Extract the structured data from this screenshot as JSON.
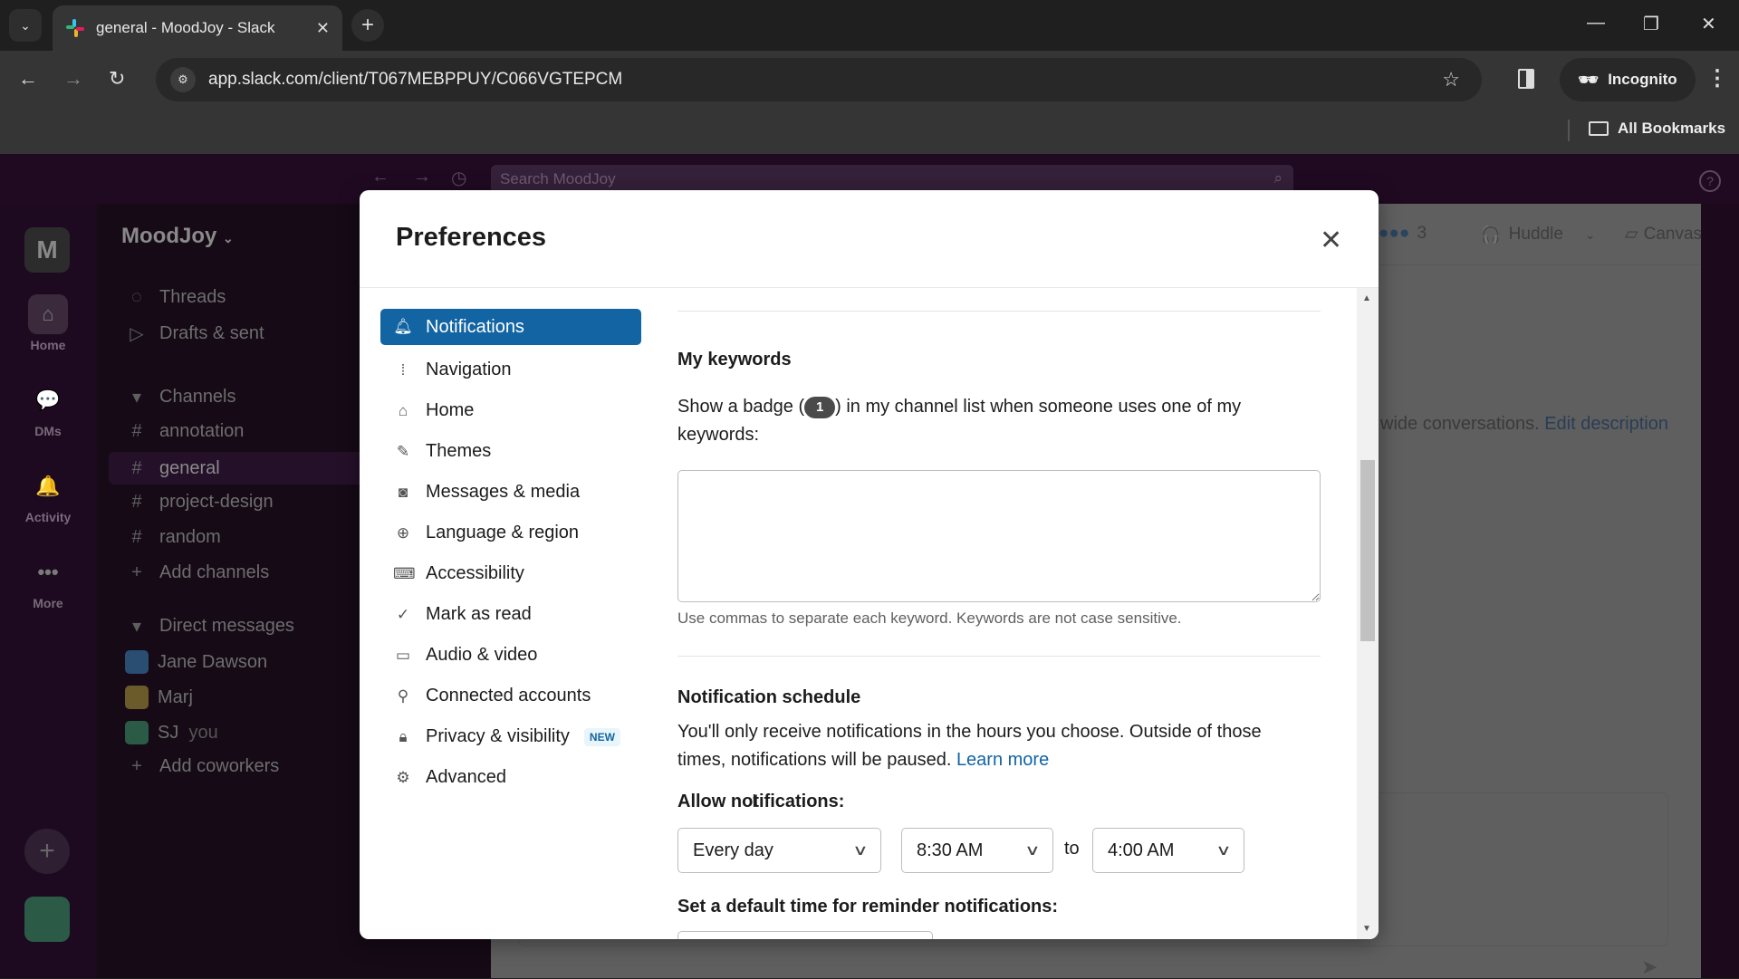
{
  "browser": {
    "tab_title": "general - MoodJoy - Slack",
    "url": "app.slack.com/client/T067MEBPPUY/C066VGTEPCM",
    "profile_label": "Incognito",
    "bookmarks_label": "All Bookmarks"
  },
  "slack": {
    "search_placeholder": "Search MoodJoy",
    "workspace_initial": "M",
    "workspace_name": "MoodJoy",
    "rail": [
      {
        "label": "Home",
        "icon": "home-icon"
      },
      {
        "label": "DMs",
        "icon": "dms-icon"
      },
      {
        "label": "Activity",
        "icon": "bell-icon"
      },
      {
        "label": "More",
        "icon": "more-icon"
      }
    ],
    "top_items": [
      {
        "label": "Threads",
        "icon": "threads-icon"
      },
      {
        "label": "Drafts & sent",
        "icon": "send-icon"
      }
    ],
    "channels_header": "Channels",
    "channels": [
      "annotation",
      "general",
      "project-design",
      "random"
    ],
    "active_channel": "general",
    "add_channels": "Add channels",
    "dms_header": "Direct messages",
    "dms": [
      {
        "name": "Jane Dawson",
        "suffix": "",
        "color": "#2d6fb0"
      },
      {
        "name": "Marj",
        "suffix": "",
        "color": "#c9a52a"
      },
      {
        "name": "SJ",
        "suffix": "you",
        "color": "#2e8b57"
      }
    ],
    "add_coworkers": "Add coworkers",
    "member_count": "3",
    "huddle_label": "Huddle",
    "canvas_label": "Canvas",
    "channel_desc": "wide conversations.",
    "edit_desc": "Edit description"
  },
  "modal": {
    "title": "Preferences",
    "nav": [
      {
        "label": "Notifications",
        "icon": "bell-icon",
        "active": true
      },
      {
        "label": "Navigation",
        "icon": "navigation-icon"
      },
      {
        "label": "Home",
        "icon": "home-icon"
      },
      {
        "label": "Themes",
        "icon": "brush-icon"
      },
      {
        "label": "Messages & media",
        "icon": "message-icon"
      },
      {
        "label": "Language & region",
        "icon": "globe-icon"
      },
      {
        "label": "Accessibility",
        "icon": "keyboard-icon"
      },
      {
        "label": "Mark as read",
        "icon": "check-circle-icon"
      },
      {
        "label": "Audio & video",
        "icon": "video-icon"
      },
      {
        "label": "Connected accounts",
        "icon": "plug-icon"
      },
      {
        "label": "Privacy & visibility",
        "icon": "lock-icon",
        "badge": "NEW"
      },
      {
        "label": "Advanced",
        "icon": "gear-icon"
      }
    ],
    "keywords": {
      "heading": "My keywords",
      "desc_before": "Show a badge (",
      "badge_value": "1",
      "desc_after": ") in my channel list when someone uses one of my keywords:",
      "value": "",
      "hint": "Use commas to separate each keyword. Keywords are not case sensitive."
    },
    "schedule": {
      "heading": "Notification schedule",
      "desc": "You'll only receive notifications in the hours you choose. Outside of those times, notifications will be paused.",
      "learn_more": "Learn more",
      "allow_label": "Allow notifications:",
      "days_value": "Every day",
      "from_value": "8:30 AM",
      "to_label": "to",
      "to_value": "4:00 AM",
      "reminder_label": "Set a default time for reminder notifications:"
    }
  }
}
